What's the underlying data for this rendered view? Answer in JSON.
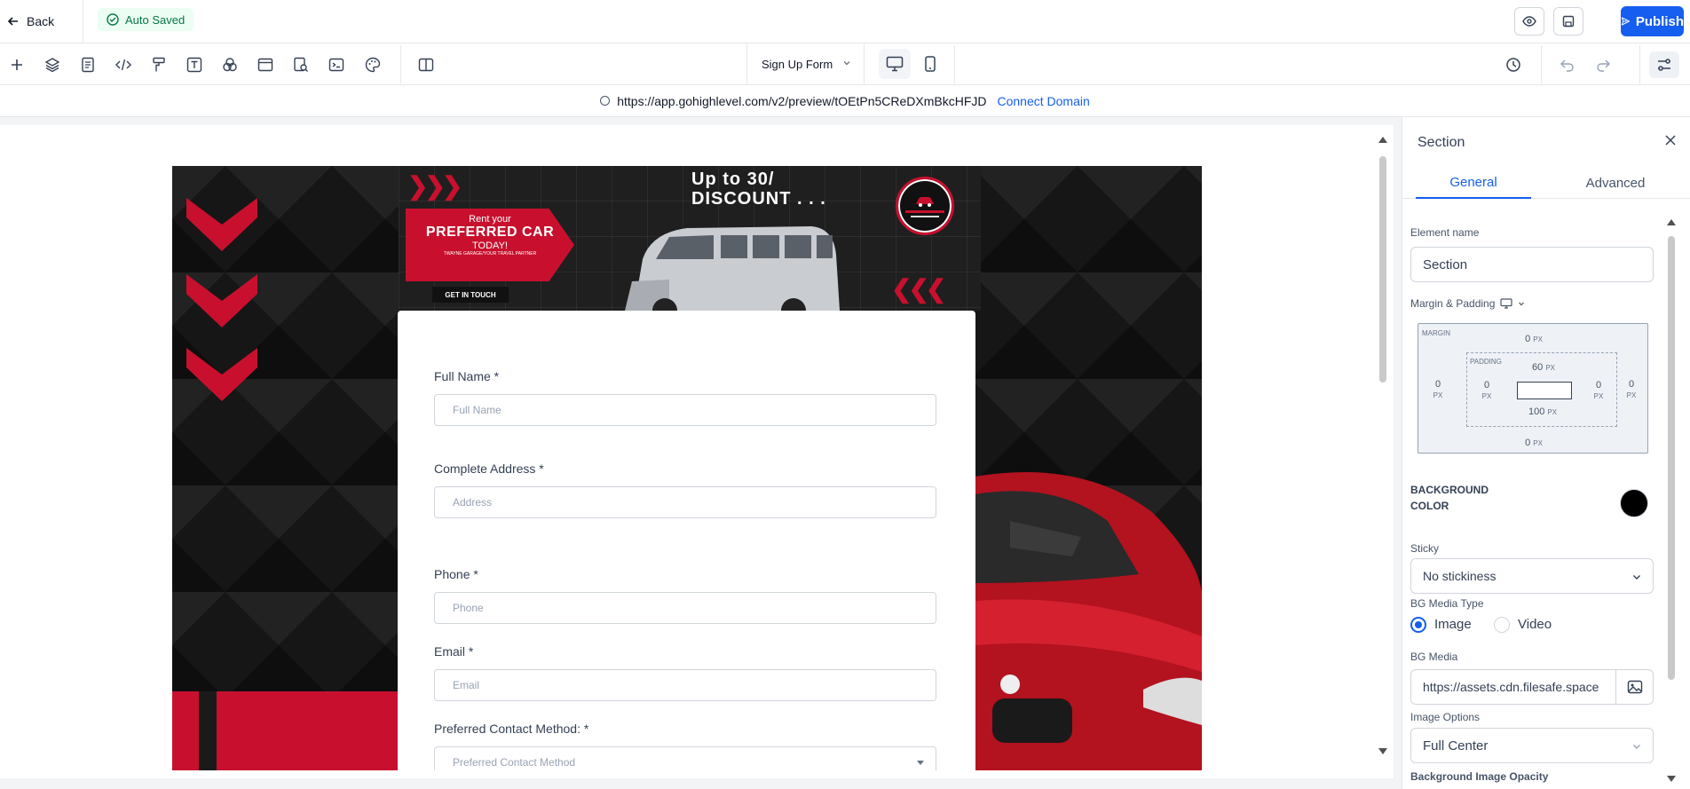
{
  "topbar": {
    "back_label": "Back",
    "autosaved_label": "Auto Saved",
    "publish_label": "Publish"
  },
  "toolbar": {
    "form_selector": "Sign Up Form"
  },
  "urlbar": {
    "url": "https://app.gohighlevel.com/v2/preview/tOEtPn5CReDXmBkcHFJD",
    "connect_domain": "Connect Domain"
  },
  "banner": {
    "rent_line1": "Rent your",
    "rent_line2": "PREFERRED CAR",
    "rent_line3": "TODAY!",
    "rent_line4": "TWAYNE GARAGE/YOUR TRAVEL PARTNER",
    "get_in_touch": "GET IN TOUCH",
    "discount_line1": "Up to 30/",
    "discount_line2": "DISCOUNT . . ."
  },
  "form": {
    "fields": [
      {
        "label": "Full Name *",
        "placeholder": "Full Name"
      },
      {
        "label": "Complete Address *",
        "placeholder": "Address"
      },
      {
        "label": "Phone *",
        "placeholder": "Phone"
      },
      {
        "label": "Email *",
        "placeholder": "Email"
      },
      {
        "label": "Preferred Contact Method: *",
        "placeholder": "Preferred Contact Method"
      }
    ]
  },
  "panel": {
    "title": "Section",
    "tabs": [
      "General",
      "Advanced"
    ],
    "active_tab": "General",
    "element_name_label": "Element name",
    "element_name_value": "Section",
    "margin_padding_label": "Margin & Padding",
    "margin_label": "MARGIN",
    "padding_label": "PADDING",
    "margin": {
      "top": "0",
      "right": "0",
      "bottom": "0",
      "left": "0"
    },
    "padding": {
      "top": "60",
      "right": "0",
      "bottom": "100",
      "left": "0"
    },
    "unit": "PX",
    "bg_color_label_1": "BACKGROUND",
    "bg_color_label_2": "COLOR",
    "bg_color_value": "#000000",
    "sticky_label": "Sticky",
    "sticky_value": "No stickiness",
    "bg_media_type_label": "BG Media Type",
    "media_types": [
      "Image",
      "Video"
    ],
    "selected_media_type": "Image",
    "bg_media_label": "BG Media",
    "bg_media_value": "https://assets.cdn.filesafe.space",
    "image_options_label": "Image Options",
    "image_options_value": "Full Center",
    "bg_opacity_label": "Background Image Opacity"
  },
  "colors": {
    "accent": "#155eef",
    "brand_red": "#c8102e",
    "success": "#067647"
  }
}
